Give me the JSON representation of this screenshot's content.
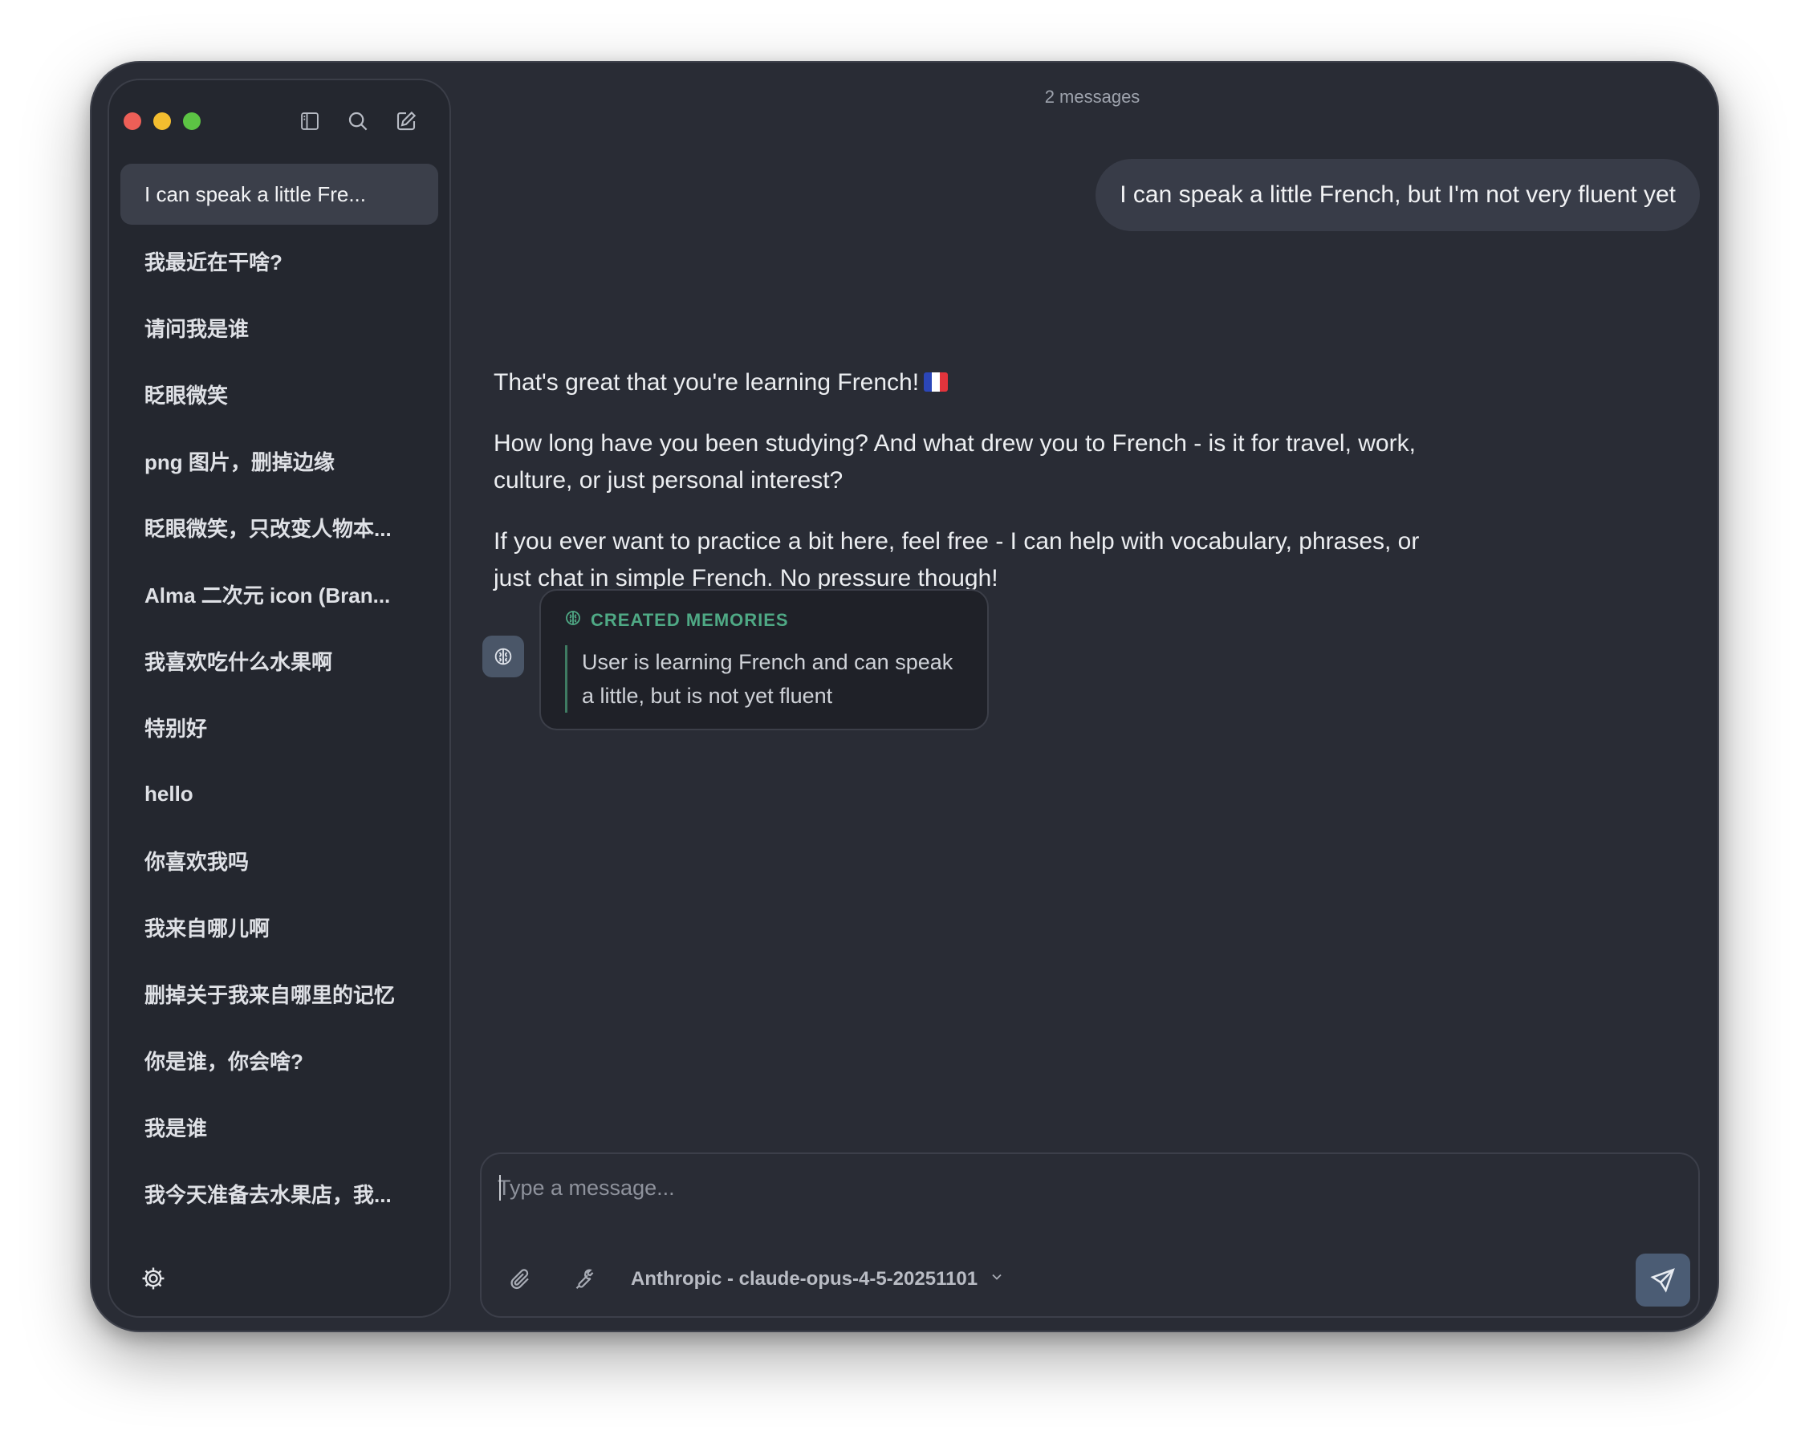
{
  "header": {
    "message_count": "2 messages"
  },
  "sidebar": {
    "icons": [
      "sidebar-toggle-icon",
      "search-icon",
      "new-chat-icon"
    ],
    "items": [
      {
        "label": "I can speak a little Fre...",
        "active": true
      },
      {
        "label": "我最近在干啥?"
      },
      {
        "label": "请问我是谁"
      },
      {
        "label": "眨眼微笑"
      },
      {
        "label": "png 图片，删掉边缘"
      },
      {
        "label": "眨眼微笑，只改变人物本..."
      },
      {
        "label": "Alma 二次元 icon (Bran..."
      },
      {
        "label": "我喜欢吃什么水果啊"
      },
      {
        "label": "特别好"
      },
      {
        "label": "hello"
      },
      {
        "label": "你喜欢我吗"
      },
      {
        "label": "我来自哪儿啊"
      },
      {
        "label": "删掉关于我来自哪里的记忆"
      },
      {
        "label": "你是谁，你会啥?"
      },
      {
        "label": "我是谁"
      },
      {
        "label": "我今天准备去水果店，我..."
      }
    ]
  },
  "conversation": {
    "user_message": "I can speak a little French, but I'm not very fluent yet",
    "assistant": {
      "p1": "That's great that you're learning French!",
      "p2": "How long have you been studying? And what drew you to French - is it for travel, work, culture, or just personal interest?",
      "p3": "If you ever want to practice a bit here, feel free - I can help with vocabulary, phrases, or just chat in simple French. No pressure though!"
    },
    "memory": {
      "title": "CREATED MEMORIES",
      "text": "User is learning French and can speak a little, but is not yet fluent"
    }
  },
  "composer": {
    "placeholder": "Type a message...",
    "value": "",
    "model": "Anthropic - claude-opus-4-5-20251101"
  },
  "colors": {
    "window_bg": "#292c35",
    "sidebar_bg": "#24272f",
    "accent_green": "#4fa985",
    "send_bg": "#4b5c74"
  }
}
